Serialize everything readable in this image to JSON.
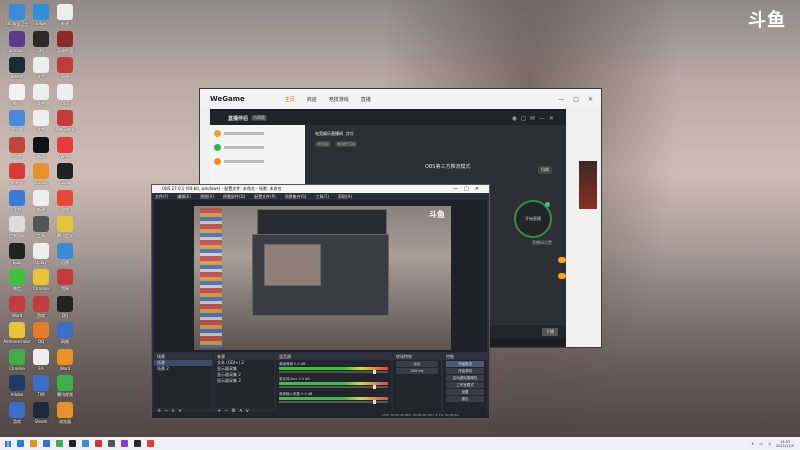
{
  "corner_logo": "斗鱼",
  "desktop_icons": [
    {
      "label": "360安全卫士",
      "color": "#3c8ad8"
    },
    {
      "label": "qqmusic",
      "color": "#5b3c8a"
    },
    {
      "label": "Steam",
      "color": "#1b2a3b"
    },
    {
      "label": "微信",
      "color": "#f2f2f2"
    },
    {
      "label": "此电脑",
      "color": "#4a88d8"
    },
    {
      "label": "游戏",
      "color": "#c2473a"
    },
    {
      "label": "网易云",
      "color": "#d83a3a"
    },
    {
      "label": "飞书",
      "color": "#3a7ad8"
    },
    {
      "label": "控制面板",
      "color": "#ddd"
    },
    {
      "label": "Epic",
      "color": "#222"
    },
    {
      "label": "微信",
      "color": "#3fbf3f"
    },
    {
      "label": "Word",
      "color": "#c23a3a"
    },
    {
      "label": "Administrator",
      "color": "#e8c23a"
    },
    {
      "label": "Chrome",
      "color": "#3fae4a"
    },
    {
      "label": "Adobe",
      "color": "#1f3b5f"
    },
    {
      "label": "游戏",
      "color": "#3a6fc9"
    },
    {
      "label": "Edge",
      "color": "#2f8fd8"
    },
    {
      "label": "QQ",
      "color": "#2a2a2a"
    },
    {
      "label": "文件",
      "color": "#eee"
    },
    {
      "label": "文件",
      "color": "#eee"
    },
    {
      "label": "文件",
      "color": "#eee"
    },
    {
      "label": "新建",
      "color": "#111"
    },
    {
      "label": "CS:GO",
      "color": "#e8902a"
    },
    {
      "label": "新建",
      "color": "#eee"
    },
    {
      "label": "工具",
      "color": "#555"
    },
    {
      "label": "Uplay",
      "color": "#eee"
    },
    {
      "label": "Chrome",
      "color": "#e8c23a"
    },
    {
      "label": "游戏",
      "color": "#c23a3a"
    },
    {
      "label": "QQ",
      "color": "#e87a2a"
    },
    {
      "label": "EA",
      "color": "#eee"
    },
    {
      "label": "TIM",
      "color": "#3a6fc9"
    },
    {
      "label": "Steam",
      "color": "#1b2a3b"
    },
    {
      "label": "新建",
      "color": "#eee"
    },
    {
      "label": "英雄联盟",
      "color": "#8a2a2a"
    },
    {
      "label": "网易",
      "color": "#c23a3a"
    },
    {
      "label": "OBS",
      "color": "#eee"
    },
    {
      "label": "WeGame",
      "color": "#c23a3a"
    },
    {
      "label": "WPS",
      "color": "#e83a3a"
    },
    {
      "label": "Cocos",
      "color": "#222"
    },
    {
      "label": "游戏",
      "color": "#e84a3a"
    },
    {
      "label": "腾讯会议",
      "color": "#e8c23a"
    },
    {
      "label": "迅雷",
      "color": "#3a8ad8"
    },
    {
      "label": "剑网",
      "color": "#c23a3a"
    },
    {
      "label": "QQ",
      "color": "#222"
    },
    {
      "label": "网络",
      "color": "#3a6fc9"
    },
    {
      "label": "Word",
      "color": "#e8902a"
    },
    {
      "label": "腾讯视频",
      "color": "#3fae4a"
    },
    {
      "label": "浏览器",
      "color": "#e8902a"
    }
  ],
  "wegame": {
    "logo": "WeGame",
    "nav": [
      "主页",
      "商店",
      "竞技游戏",
      "直播"
    ],
    "live_tool_brand": "直播伴侣",
    "live_tool_tag": "内测版",
    "stream_title": "电竞娱乐直播间",
    "stream_category": "游戏",
    "chips": [
      "游戏直播",
      "电竞娱乐直播"
    ],
    "mode_text": "OBS第三方推流模式",
    "small_button": "切换",
    "start_button": "开始直播",
    "under_start": "直播间设置",
    "end_button": "下播"
  },
  "obs": {
    "title": "OBS 27.0.1 (64-bit, windows) - 配置文件: 未命名 - 场景: 未命名",
    "menu": [
      "文件(F)",
      "编辑(E)",
      "视图(V)",
      "停靠部件(D)",
      "配置文件(P)",
      "场景集合(S)",
      "工具(T)",
      "帮助(H)"
    ],
    "preview_logo": "斗鱼",
    "scenes_header": "场景",
    "scenes": [
      "场景",
      "场景 2"
    ],
    "sources_header": "来源",
    "sources": [
      "文本 (GDI+) 2",
      "显示器采集",
      "显示器采集 2",
      "显示器采集 3"
    ],
    "mixer_header": "混音器",
    "mixer": [
      {
        "name": "桌面音频",
        "level": "0.0 dB"
      },
      {
        "name": "麦克风/Aux",
        "level": "0.0 dB"
      },
      {
        "name": "音频输入采集",
        "level": "0.0 dB"
      }
    ],
    "transitions_header": "转场特效",
    "transition_type": "淡出",
    "transition_duration": "300 ms",
    "controls_header": "控制",
    "controls": [
      "开始推流",
      "开始录制",
      "启动虚拟摄像机",
      "工作室模式",
      "设置",
      "退出"
    ],
    "status": "LIVE: 00:00:00   REC: 00:00:00   CPU: 4.7%, 60.00 fps"
  },
  "taskbar": {
    "time": "14:03",
    "date": "2021/12/9",
    "apps": [
      "#2a7bd8",
      "#e8902a",
      "#3a6fc9",
      "#3fae4a",
      "#222",
      "#3a8ad8",
      "#c23a3a",
      "#555",
      "#8a3ad8",
      "#2a2a2a",
      "#e83a3a"
    ]
  }
}
